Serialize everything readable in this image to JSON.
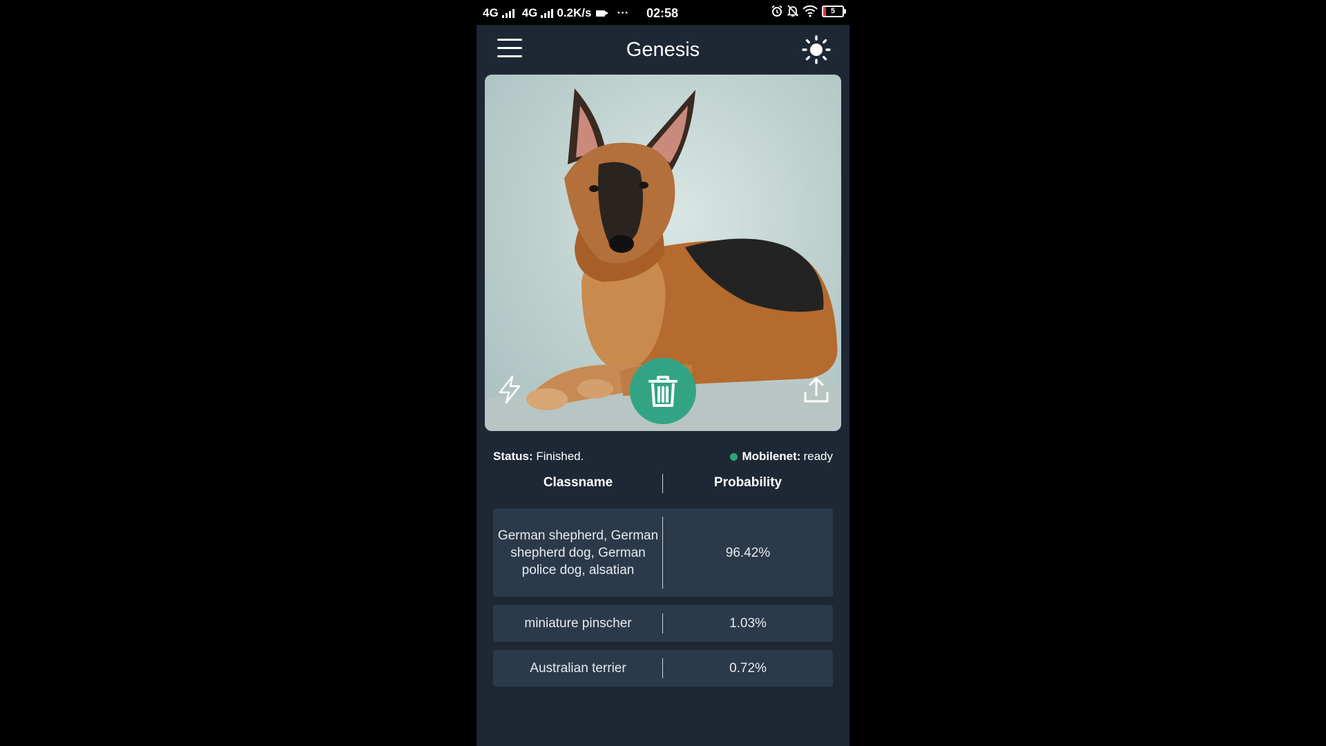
{
  "status_bar": {
    "net1": "4G",
    "net2": "4G",
    "speed": "0.2K/s",
    "more": "···",
    "time": "02:58",
    "battery": "5"
  },
  "app_bar": {
    "title": "Genesis",
    "menu_icon": "hamburger-menu-icon",
    "theme_icon": "sun-icon"
  },
  "image_card": {
    "flash_icon": "lightning-icon",
    "delete_icon": "trash-icon",
    "upload_icon": "upload-icon",
    "delete_color": "#33a483"
  },
  "status": {
    "label": "Status:",
    "value": "Finished.",
    "model_label": "Mobilenet:",
    "model_value": "ready",
    "model_dot_color": "#2ea679"
  },
  "table": {
    "col1": "Classname",
    "col2": "Probability",
    "rows": [
      {
        "classname": "German shepherd, German shepherd dog, German police dog, alsatian",
        "probability": "96.42%"
      },
      {
        "classname": "miniature pinscher",
        "probability": "1.03%"
      },
      {
        "classname": "Australian terrier",
        "probability": "0.72%"
      }
    ]
  },
  "colors": {
    "background": "#000000",
    "panel": "#1e2835",
    "row": "#2b3a4b",
    "accent": "#33a483"
  }
}
